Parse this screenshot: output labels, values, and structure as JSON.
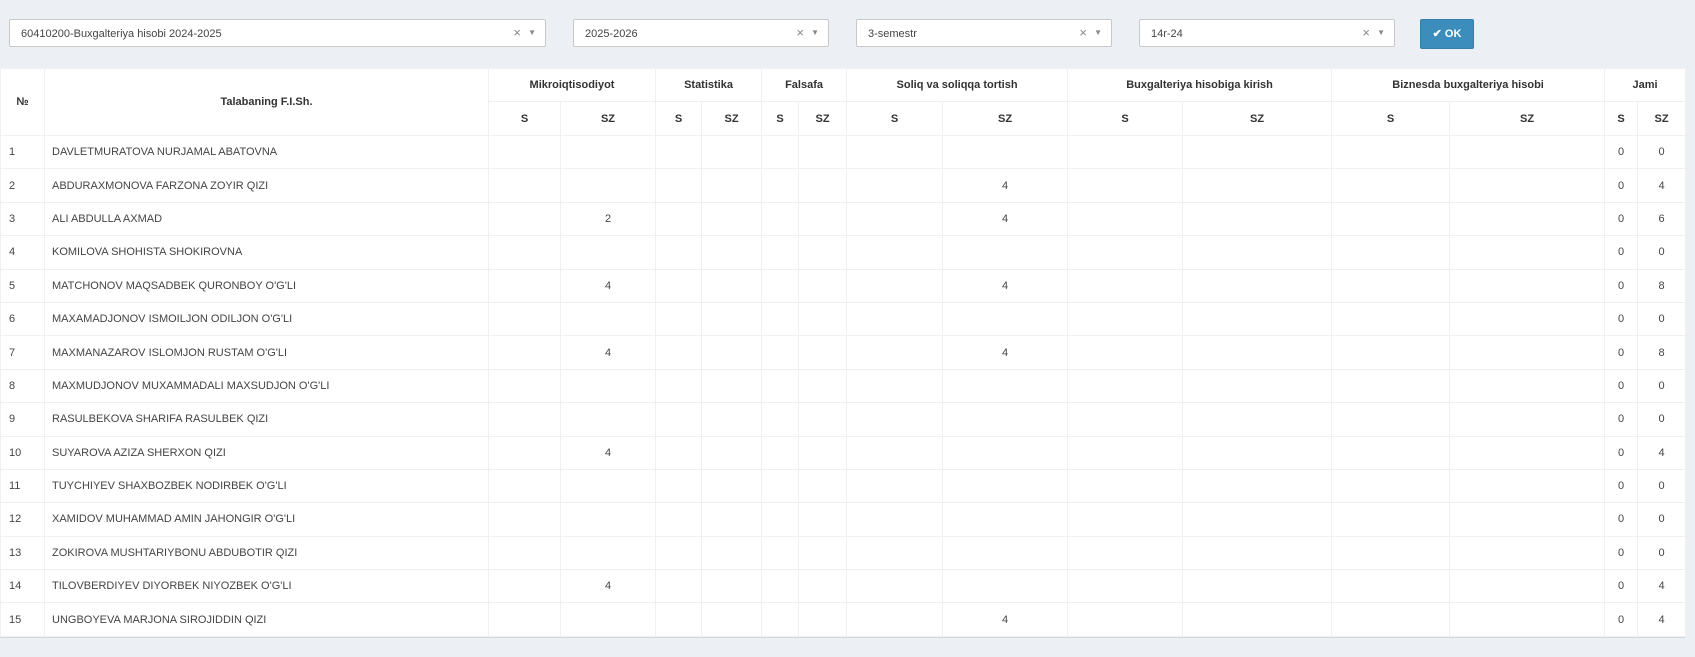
{
  "filters": {
    "program": "60410200-Buxgalteriya hisobi 2024-2025",
    "year": "2025-2026",
    "semester": "3-semestr",
    "group": "14r-24",
    "clear_symbol": "×",
    "arrow_symbol": "▼",
    "ok_label": "OK",
    "ok_icon": "✔"
  },
  "table": {
    "col_num": "№",
    "col_name": "Talabaning F.I.Sh.",
    "subjects": [
      "Mikroiqtisodiyot",
      "Statistika",
      "Falsafa",
      "Soliq va soliqqa tortish",
      "Buxgalteriya hisobiga kirish",
      "Biznesda buxgalteriya hisobi",
      "Jami"
    ],
    "sub_s": "S",
    "sub_sz": "SZ",
    "rows": [
      {
        "num": "1",
        "name": "DAVLETMURATOVA NURJAMAL ABATOVNA",
        "cells": [
          "",
          "",
          "",
          "",
          "",
          "",
          "",
          "",
          "",
          "",
          "",
          "",
          "0",
          "0"
        ]
      },
      {
        "num": "2",
        "name": "ABDURAXMONOVA FARZONA ZOYIR QIZI",
        "cells": [
          "",
          "",
          "",
          "",
          "",
          "",
          "",
          "4",
          "",
          "",
          "",
          "",
          "0",
          "4"
        ]
      },
      {
        "num": "3",
        "name": "ALI ABDULLA AXMAD",
        "cells": [
          "",
          "2",
          "",
          "",
          "",
          "",
          "",
          "4",
          "",
          "",
          "",
          "",
          "0",
          "6"
        ]
      },
      {
        "num": "4",
        "name": "KOMILOVA SHOHISTA SHOKIROVNA",
        "cells": [
          "",
          "",
          "",
          "",
          "",
          "",
          "",
          "",
          "",
          "",
          "",
          "",
          "0",
          "0"
        ]
      },
      {
        "num": "5",
        "name": "MATCHONOV MAQSADBEK QURONBOY O'G'LI",
        "cells": [
          "",
          "4",
          "",
          "",
          "",
          "",
          "",
          "4",
          "",
          "",
          "",
          "",
          "0",
          "8"
        ]
      },
      {
        "num": "6",
        "name": "MAXAMADJONOV ISMOILJON ODILJON O'G'LI",
        "cells": [
          "",
          "",
          "",
          "",
          "",
          "",
          "",
          "",
          "",
          "",
          "",
          "",
          "0",
          "0"
        ]
      },
      {
        "num": "7",
        "name": "MAXMANAZAROV ISLOMJON RUSTAM O'G'LI",
        "cells": [
          "",
          "4",
          "",
          "",
          "",
          "",
          "",
          "4",
          "",
          "",
          "",
          "",
          "0",
          "8"
        ]
      },
      {
        "num": "8",
        "name": "MAXMUDJONOV MUXAMMADALI MAXSUDJON O'G'LI",
        "cells": [
          "",
          "",
          "",
          "",
          "",
          "",
          "",
          "",
          "",
          "",
          "",
          "",
          "0",
          "0"
        ]
      },
      {
        "num": "9",
        "name": "RASULBEKOVA SHARIFA RASULBEK QIZI",
        "cells": [
          "",
          "",
          "",
          "",
          "",
          "",
          "",
          "",
          "",
          "",
          "",
          "",
          "0",
          "0"
        ]
      },
      {
        "num": "10",
        "name": "SUYAROVA AZIZA SHERXON QIZI",
        "cells": [
          "",
          "4",
          "",
          "",
          "",
          "",
          "",
          "",
          "",
          "",
          "",
          "",
          "0",
          "4"
        ]
      },
      {
        "num": "11",
        "name": "TUYCHIYEV SHAXBOZBEK NODIRBEK O'G'LI",
        "cells": [
          "",
          "",
          "",
          "",
          "",
          "",
          "",
          "",
          "",
          "",
          "",
          "",
          "0",
          "0"
        ]
      },
      {
        "num": "12",
        "name": "XAMIDOV MUHAMMAD AMIN JAHONGIR O'G'LI",
        "cells": [
          "",
          "",
          "",
          "",
          "",
          "",
          "",
          "",
          "",
          "",
          "",
          "",
          "0",
          "0"
        ]
      },
      {
        "num": "13",
        "name": "ZOKIROVA MUSHTARIYBONU ABDUBOTIR QIZI",
        "cells": [
          "",
          "",
          "",
          "",
          "",
          "",
          "",
          "",
          "",
          "",
          "",
          "",
          "0",
          "0"
        ]
      },
      {
        "num": "14",
        "name": "TILOVBERDIYEV DIYORBEK NIYOZBEK O'G'LI",
        "cells": [
          "",
          "4",
          "",
          "",
          "",
          "",
          "",
          "",
          "",
          "",
          "",
          "",
          "0",
          "4"
        ]
      },
      {
        "num": "15",
        "name": "UNGBOYEVA MARJONA SIROJIDDIN QIZI",
        "cells": [
          "",
          "",
          "",
          "",
          "",
          "",
          "",
          "4",
          "",
          "",
          "",
          "",
          "0",
          "4"
        ]
      }
    ]
  }
}
